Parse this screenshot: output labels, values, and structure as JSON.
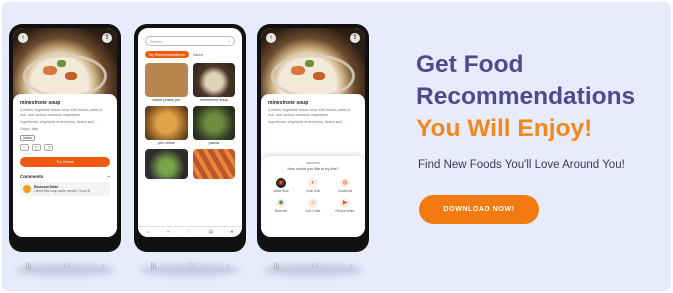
{
  "headline": {
    "line1": "Get Food",
    "line2": "Recommendations",
    "line3": "You Will Enjoy!"
  },
  "subheading": "Find New Foods You'll Love Around You!",
  "cta_button": "DOWNLOAD NOW!",
  "colors": {
    "brand_purple": "#4f4a8c",
    "brand_orange": "#f27a10",
    "background": "#e7ebfb"
  },
  "phone1": {
    "dish_title": "minestrone soup",
    "description": "A hearty vegetable based soup with beans, pasta or rice, and various seasonal vegetables",
    "ingredients": "Ingredients: vegetable broth/celery, beans and ...",
    "origin": "Origin: Italy",
    "tag": "Italian",
    "cta": "Try it Now",
    "comments_label": "Comments",
    "comment_user": "BlossomTaste",
    "comment_text": "I liked this soup taste overall. Good it!"
  },
  "phone2": {
    "search_placeholder": "Search",
    "tab_active": "My Recommendations",
    "tab_other": "Saved",
    "tiles": [
      {
        "label": "sweet potato pie",
        "color": "#b8864e"
      },
      {
        "label": "minestrone soup",
        "color": "#5a4030"
      },
      {
        "label": "pho cheat",
        "color": "#c98a35"
      },
      {
        "label": "paella",
        "color": "#5c7a3a"
      },
      {
        "label": "",
        "color": "#3a3a3a"
      },
      {
        "label": "",
        "color": "#b24a2a"
      }
    ],
    "bottom_tabs": [
      "Home",
      "Recipes",
      "My Saves",
      "Store",
      "Profile"
    ]
  },
  "phone3": {
    "dish_title": "minestrone soup",
    "description": "A hearty vegetable based soup with beans, pasta or rice, and various seasonal vegetables",
    "ingredients": "Ingredients: vegetable broth/celery, beans and ...",
    "sheet_title": "How would you like to try this?",
    "options": [
      {
        "label": "Make Now",
        "icon": "pot-icon"
      },
      {
        "label": "Grab it All",
        "icon": "cart-icon"
      },
      {
        "label": "Cookbook",
        "icon": "book-icon"
      },
      {
        "label": "Near Me",
        "icon": "pin-icon"
      },
      {
        "label": "Just Order",
        "icon": "bag-icon"
      },
      {
        "label": "Recipe Video",
        "icon": "video-icon"
      }
    ]
  }
}
